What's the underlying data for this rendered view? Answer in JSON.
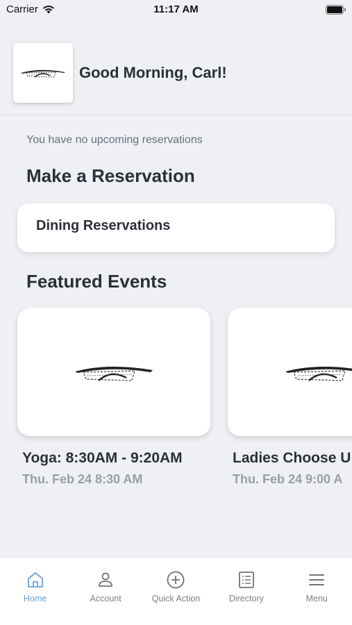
{
  "status": {
    "carrier": "Carrier",
    "time": "11:17 AM"
  },
  "header": {
    "greeting": "Good Morning, Carl!",
    "logo_icon": "bridge-logo"
  },
  "reservations": {
    "empty_text": "You have no upcoming reservations"
  },
  "make_reservation": {
    "title": "Make a Reservation",
    "items": [
      {
        "label": "Dining Reservations"
      }
    ]
  },
  "featured": {
    "title": "Featured Events",
    "events": [
      {
        "title": "Yoga: 8:30AM - 9:20AM",
        "date": "Thu. Feb 24 8:30 AM"
      },
      {
        "title": "Ladies Choose U",
        "date": "Thu. Feb 24 9:00 A"
      }
    ]
  },
  "tabbar": {
    "items": [
      {
        "label": "Home",
        "icon": "home-icon",
        "active": true
      },
      {
        "label": "Account",
        "icon": "person-icon"
      },
      {
        "label": "Quick Action",
        "icon": "plus-circle-icon"
      },
      {
        "label": "Directory",
        "icon": "list-doc-icon"
      },
      {
        "label": "Menu",
        "icon": "hamburger-icon"
      }
    ]
  },
  "colors": {
    "background": "#eef0f4",
    "active_tab": "#6aa3d8",
    "text": "#2b2f38",
    "muted": "#9a9ea6"
  }
}
